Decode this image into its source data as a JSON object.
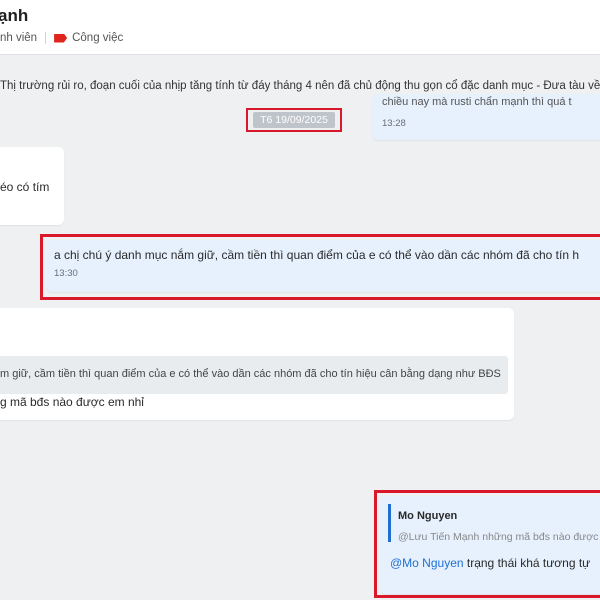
{
  "header": {
    "title": "ạnh",
    "members_label": "nh viên",
    "tag_label": "Công việc"
  },
  "pinned_text": "Thị trường rủi ro, đoạn cuối của nhịp tăng tính từ đáy tháng 4 nên đã chủ động thu gọn cổ đặc danh mục - Đưa tàu về gần l",
  "date_divider": "T6 19/09/2025",
  "messages": {
    "right_top": {
      "text": "chiều nay mà rusti chẩn mạnh thì quá t",
      "time": "13:28"
    },
    "left_small": {
      "text": "éo có tím"
    },
    "highlighted_mine": {
      "text": "a chị chú ý danh mục nắm giữ, cầm tiền thì quan điểm của e có thể vào dần các nhóm đã cho tín h",
      "time": "13:30"
    },
    "left_reply": {
      "quote_text": "m giữ, cầm tiền thì quan điểm của e có thể vào dần các nhóm đã cho tín hiệu cân bằng dạng như BĐS",
      "text": "g mã bđs nào được em nhỉ"
    },
    "bottom_reply": {
      "quote_author": "Mo Nguyen",
      "quote_text": "@Lưu Tiến Mạnh những mã bđs nào được",
      "mention": "@Mo Nguyen",
      "text": " trạng thái khá tương tự"
    }
  },
  "colors": {
    "highlight": "#d9192b",
    "mention": "#1f6fd1",
    "tag": "#e0251c"
  }
}
